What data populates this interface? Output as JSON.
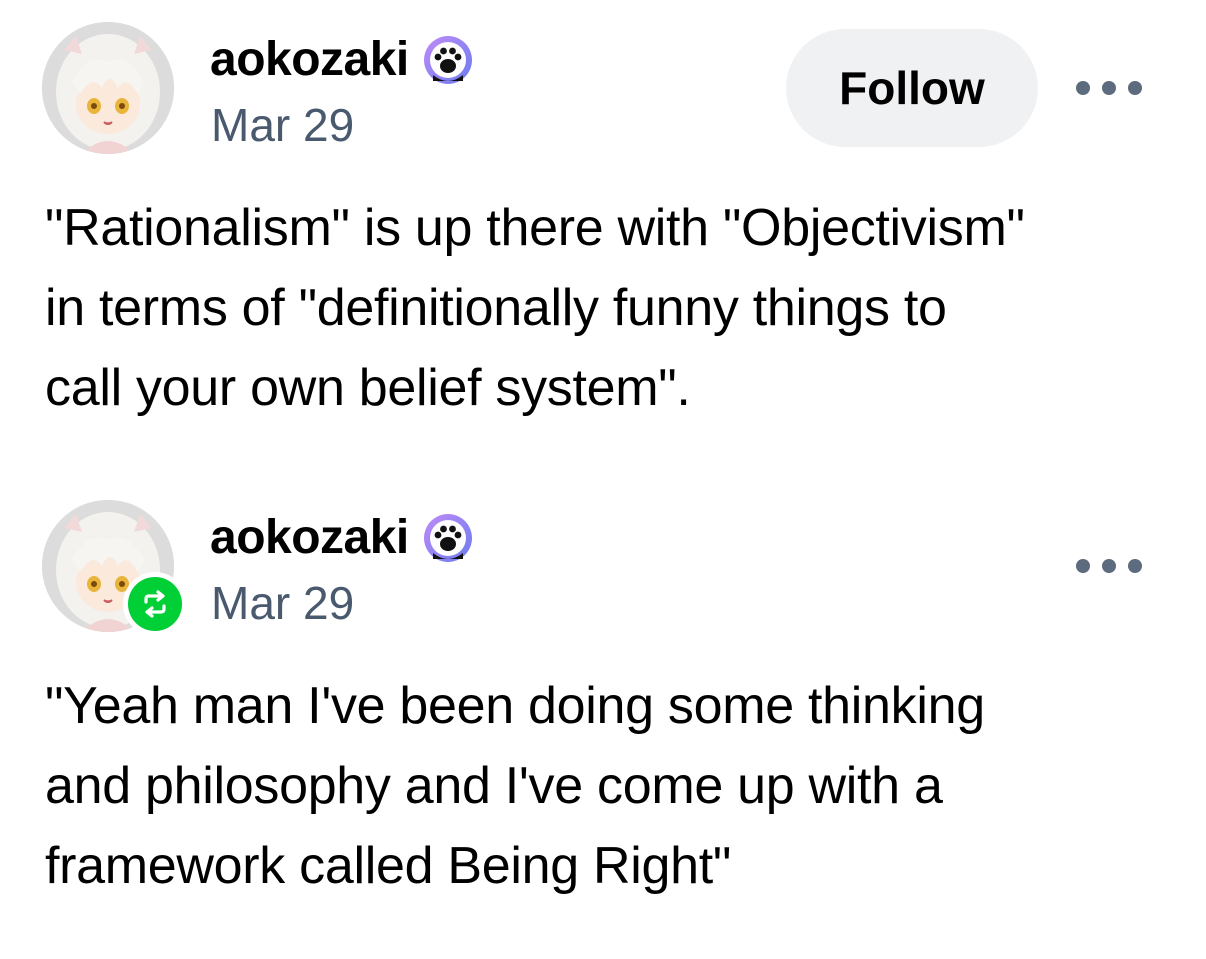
{
  "posts": [
    {
      "username": "aokozaki",
      "date": "Mar 29",
      "follow_label": "Follow",
      "is_reblog": false,
      "badge_icon": "paw-print-badge-icon",
      "avatar": "anime-figure-avatar",
      "more_icon": "more-options-icon",
      "body_lines": [
        "\"Rationalism\" is up there with \"Objectivism\"",
        "in terms of \"definitionally funny things to",
        "call your own belief system\"."
      ]
    },
    {
      "username": "aokozaki",
      "date": "Mar 29",
      "is_reblog": true,
      "badge_icon": "paw-print-badge-icon",
      "reblog_icon": "reblog-icon",
      "avatar": "anime-figure-avatar",
      "more_icon": "more-options-icon",
      "body_lines": [
        "\"Yeah man I've been doing some thinking",
        "and philosophy and I've come up with a",
        "framework called Being Right\""
      ]
    }
  ],
  "colors": {
    "date_text": "#4a5a6e",
    "follow_bg": "#f0f1f3",
    "reblog_green": "#00cf35",
    "badge_purple": "#a06cf0",
    "more_dots": "#5c6b7e"
  }
}
